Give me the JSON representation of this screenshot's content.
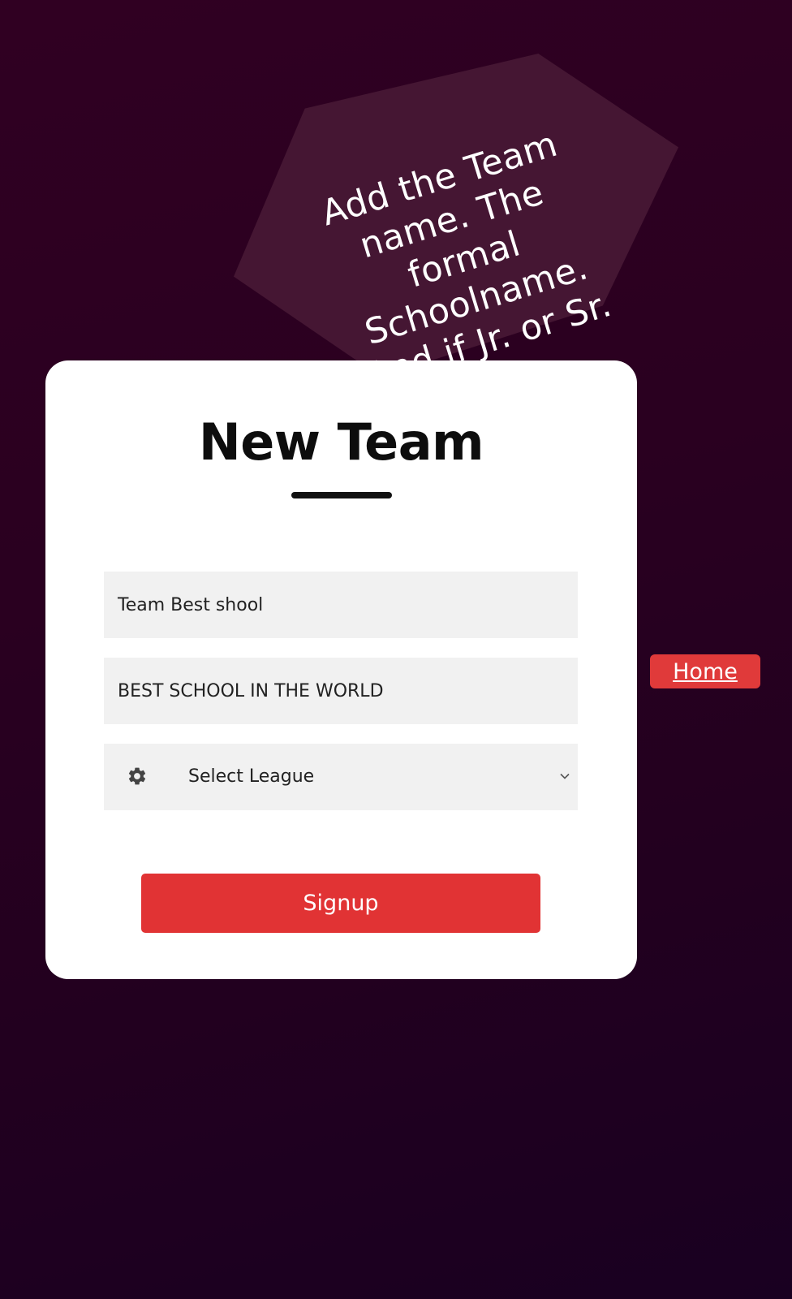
{
  "annotation": {
    "text": "Add the Team\nname. The\nformal\nSchoolname.\nAnd if Jr. or Sr."
  },
  "form": {
    "title": "New Team",
    "team_name_value": "Team Best shool",
    "school_name_value": "BEST SCHOOL IN THE WORLD",
    "league_select": {
      "selected": "Select League",
      "icon": "gear-icon"
    },
    "submit_label": "Signup"
  },
  "nav": {
    "home_label": "Home"
  },
  "colors": {
    "background": "#2a0020",
    "annotation_fill": "#451633",
    "accent": "#e13334",
    "field_background": "#f1f1f1"
  }
}
